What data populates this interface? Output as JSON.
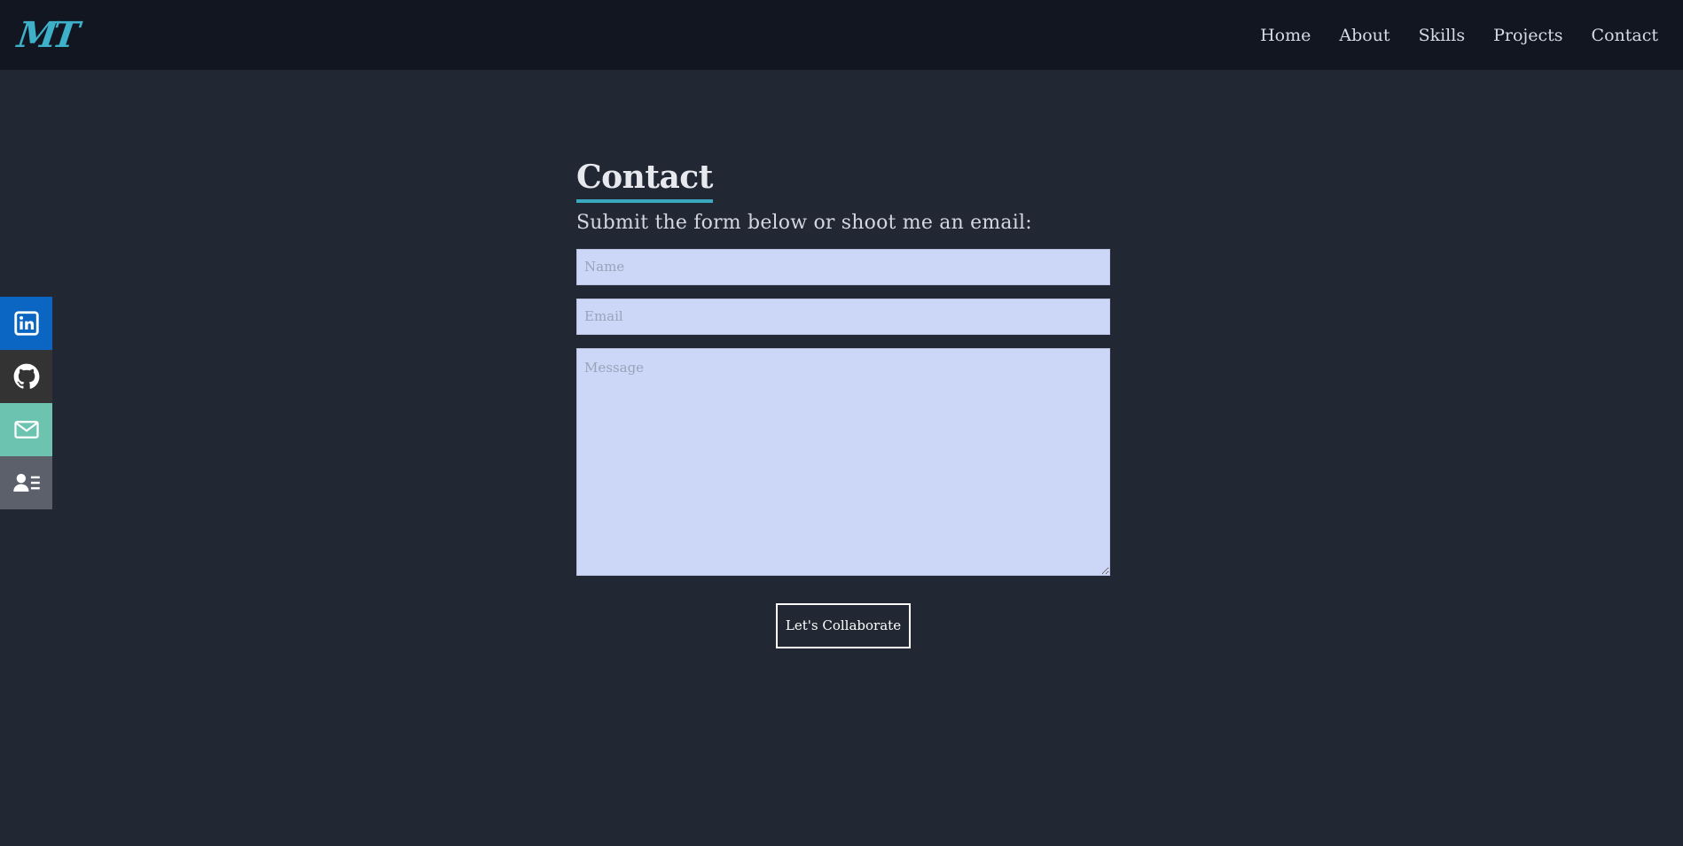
{
  "header": {
    "logo_text": "MT",
    "nav": [
      "Home",
      "About",
      "Skills",
      "Projects",
      "Contact"
    ]
  },
  "social": [
    {
      "icon": "linkedin-icon",
      "color": "#0a66c2"
    },
    {
      "icon": "github-icon",
      "color": "#333333"
    },
    {
      "icon": "email-icon",
      "color": "#6cc4b0"
    },
    {
      "icon": "resume-icon",
      "color": "#5b606b"
    }
  ],
  "contact": {
    "title": "Contact",
    "subtitle": "Submit the form below or shoot me an email:",
    "name_placeholder": "Name",
    "email_placeholder": "Email",
    "message_placeholder": "Message",
    "submit_label": "Let's Collaborate"
  },
  "colors": {
    "background": "#212733",
    "navbar": "#111620",
    "accent": "#3aa9bf",
    "field_bg": "#ccd6f6"
  }
}
